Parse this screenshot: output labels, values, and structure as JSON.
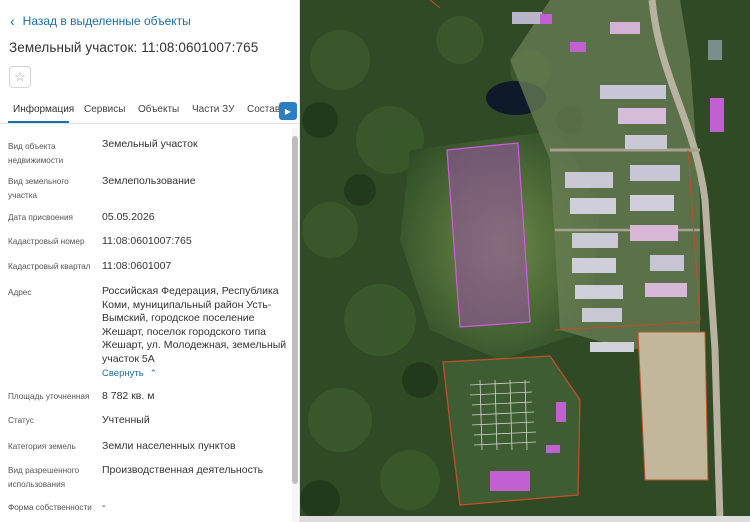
{
  "back_link": "Назад в выделенные объекты",
  "title": "Земельный участок: 11:08:0601007:765",
  "favorite_icon": "star-icon",
  "tabs": [
    {
      "label": "Информация",
      "active": true
    },
    {
      "label": "Сервисы"
    },
    {
      "label": "Объекты"
    },
    {
      "label": "Части ЗУ"
    },
    {
      "label": "Состав"
    }
  ],
  "fields": [
    {
      "label": "Вид объекта недвижимости",
      "value": "Земельный участок"
    },
    {
      "label": "Вид земельного участка",
      "value": "Землепользование"
    },
    {
      "label": "Дата присвоения",
      "value": "05.05.2026"
    },
    {
      "label": "Кадастровый номер",
      "value": "11:08:0601007:765"
    },
    {
      "label": "Кадастровый квартал",
      "value": "11:08:0601007"
    },
    {
      "label": "Адрес",
      "value": "Российская Федерация, Республика Коми, муниципальный район Усть-Вымский, городское поселение Жешарт, поселок городского типа Жешарт, ул. Молодежная, земельный участок 5А"
    },
    {
      "label": "Площадь уточненная",
      "value": "8 782 кв. м"
    },
    {
      "label": "Статус",
      "value": "Учтенный"
    },
    {
      "label": "Категория земель",
      "value": "Земли населенных пунктов"
    },
    {
      "label": "Вид разрешенного использования",
      "value": "Производственная деятельность"
    },
    {
      "label": "Форма собственности",
      "value": "-"
    }
  ],
  "collapse_link": "Свернуть",
  "colors": {
    "accent": "#1a6fa8",
    "parcel_fill": "#b04fc9",
    "boundary": "#c0502a"
  }
}
